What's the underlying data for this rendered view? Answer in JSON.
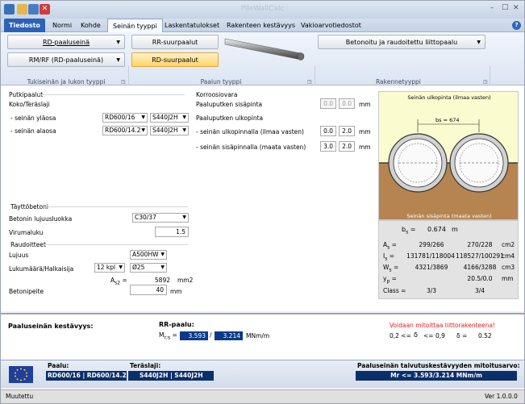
{
  "window": {
    "title": "PileWallCalc",
    "controls": [
      "–",
      "□",
      "✕"
    ],
    "help": "?"
  },
  "tabs": [
    {
      "label": "Tiedosto"
    },
    {
      "label": "Normi"
    },
    {
      "label": "Kohde"
    },
    {
      "label": "Seinän tyyppi"
    },
    {
      "label": "Laskentatulokset"
    },
    {
      "label": "Rakenteen kestävyys"
    },
    {
      "label": "Vakioarvotiedostot"
    }
  ],
  "ribbon": {
    "wall_type_1": "RD-paaluseinä",
    "wall_type_2": "RM/RF (RD-paaluseinä)",
    "group1_label": "Tukiseinän ja lukon tyyppi",
    "pile_btn_1": "RR-suurpaalut",
    "pile_btn_2": "RD-suurpaalut",
    "group2_label": "Paalun tyyppi",
    "structure_combo": "Betonoitu ja raudoitettu liittopaalu",
    "group3_label": "Rakennetyyppi"
  },
  "piles": {
    "section": "Putkipaalut",
    "subtitle": "Koko/Teräslaji",
    "upper_label": "- seinän yläosa",
    "upper_size": "RD600/16",
    "upper_steel": "S440J2H",
    "lower_label": "- seinän alaosa",
    "lower_size": "RD600/14.2",
    "lower_steel": "S440J2H"
  },
  "corrosion": {
    "section": "Korroosiovara",
    "inner_label": "Paaluputken sisäpinta",
    "inner_a": "0.0",
    "inner_b": "0.0",
    "outer_title": "Paaluputken ulkopinta",
    "outer_out_label": "- seinän ulkopinnalla (ilmaa vasten)",
    "outer_out_a": "0.0",
    "outer_out_b": "2.0",
    "outer_in_label": "- seinän sisäpinnalla (maata vasten)",
    "outer_in_a": "3.0",
    "outer_in_b": "2.0",
    "unit": "mm"
  },
  "concrete": {
    "section": "Täyttöbetoni",
    "class_label": "Betonin lujuusluokka",
    "class_value": "C30/37",
    "creep_label": "Virumaluku",
    "creep_value": "1.5"
  },
  "rebar": {
    "section": "Raudoitteet",
    "strength_label": "Lujuus",
    "strength_value": "A500HW",
    "count_label": "Lukumäärä/Halkaisija",
    "count_value": "12 kpl",
    "diam_value": "Ø25",
    "area_label": "A",
    "area_sub": "s2",
    "area_eq": "=",
    "area_value": "5892",
    "area_unit": "mm2",
    "cover_label": "Betonipeite",
    "cover_value": "40",
    "cover_unit": "mm"
  },
  "diagram": {
    "top_label": "Seinän ulkopinta (ilmaa vasten)",
    "bs_label": "bs = 674",
    "bottom_label": "Seinän sisäpinta (maata vasten)",
    "colors": {
      "air": "#fbfbd0",
      "soil": "#b58450",
      "pile": "#d2d2d2"
    }
  },
  "props": {
    "bs_label": "b",
    "bs_sub": "s",
    "bs_eq": "=",
    "bs_value": "0.674",
    "bs_unit": "m",
    "rows": [
      {
        "label": "A",
        "sub": "s",
        "eq": "=",
        "c1": "299/266",
        "c2": "270/228",
        "unit": "cm2"
      },
      {
        "label": "I",
        "sub": "s",
        "eq": "=",
        "c1": "131781/118004",
        "c2": "118527/100291",
        "unit": "cm4"
      },
      {
        "label": "W",
        "sub": "s",
        "eq": "=",
        "c1": "4321/3869",
        "c2": "4166/3288",
        "unit": "cm3"
      },
      {
        "label": "y",
        "sub": "p",
        "eq": "=",
        "c1": "",
        "c2": "20.5/0.0",
        "unit": "mm"
      },
      {
        "label": "Class",
        "sub": "",
        "eq": "=",
        "c1": "3/3",
        "c2": "3/4",
        "unit": ""
      }
    ]
  },
  "results": {
    "title": "Paaluseinän kestävyys:",
    "rr_title": "RR-paalu:",
    "mrs_label": "M",
    "mrs_sub": "r;s",
    "mrs_eq": "=",
    "val1": "3.593",
    "slash": "/",
    "val2": "3.214",
    "unit": "MNm/m",
    "warning": "Voidaan mitoittaa liittorakenteena!",
    "delta_range_a": "0,2 <=",
    "delta_sym": "δ",
    "delta_range_b": "<= 0,9",
    "delta_label": "δ =",
    "delta_value": "0.52"
  },
  "bottom": {
    "paalu_label": "Paalu:",
    "paalu_value": "RD600/16 | RD600/14.2",
    "steel_label": "Teräslaji:",
    "steel_value": "S440J2H | S440J2H",
    "bend_label": "Paaluseinän taivutuskestävyyden mitoitusarvo:",
    "bend_value": "Mr <= 3.593/3.214 MNm/m"
  },
  "status": {
    "left": "Muutettu",
    "right": "Ver 1.0.0.0"
  }
}
